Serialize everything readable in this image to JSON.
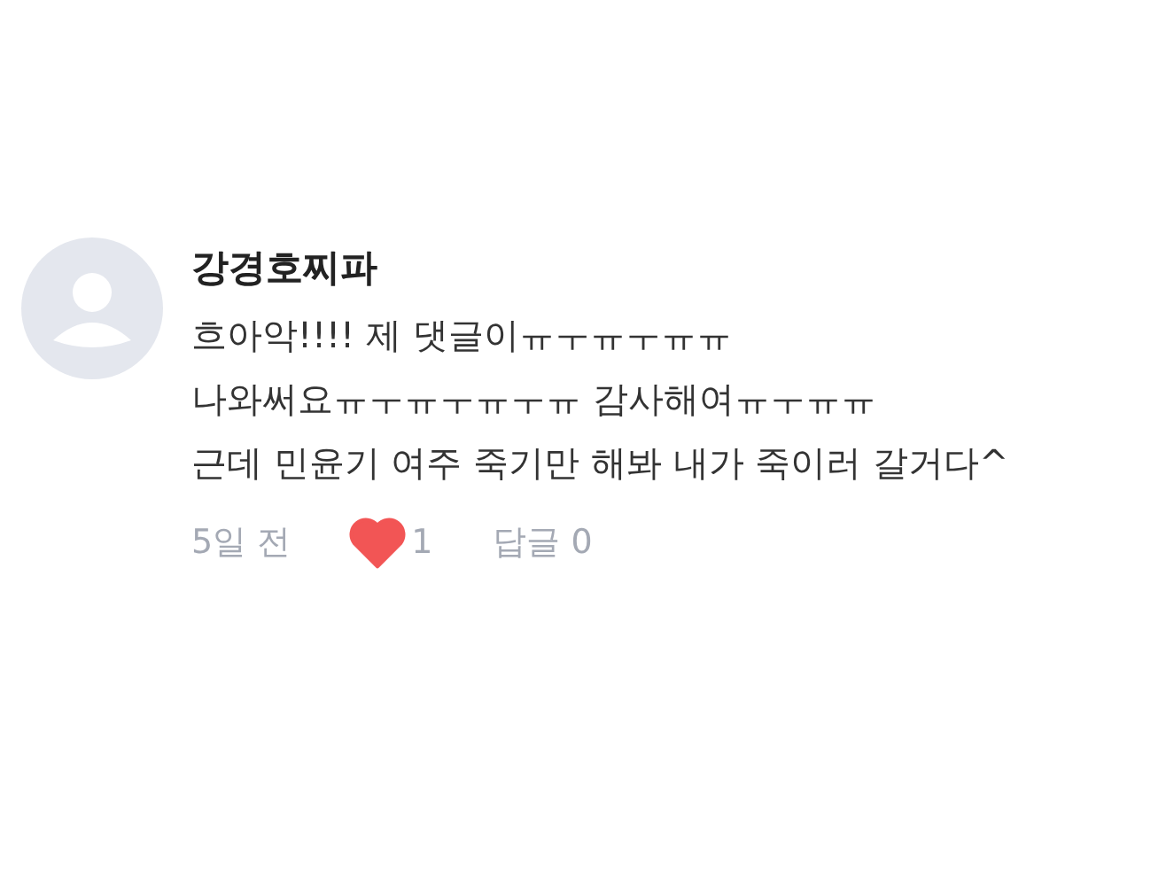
{
  "comment": {
    "author": "강경호찌파",
    "lines": [
      "흐아악!!!! 제 댓글이ㅠㅜㅠㅜㅠㅠ",
      "나와써요ㅠㅜㅠㅜㅠㅜㅠ 감사해여ㅠㅜㅠㅠ",
      "근데 민윤기 여주 죽기만 해봐 내가 죽이러 갈거다^"
    ],
    "time": "5일 전",
    "liked": true,
    "likes": "1",
    "reply": "답글 0"
  }
}
